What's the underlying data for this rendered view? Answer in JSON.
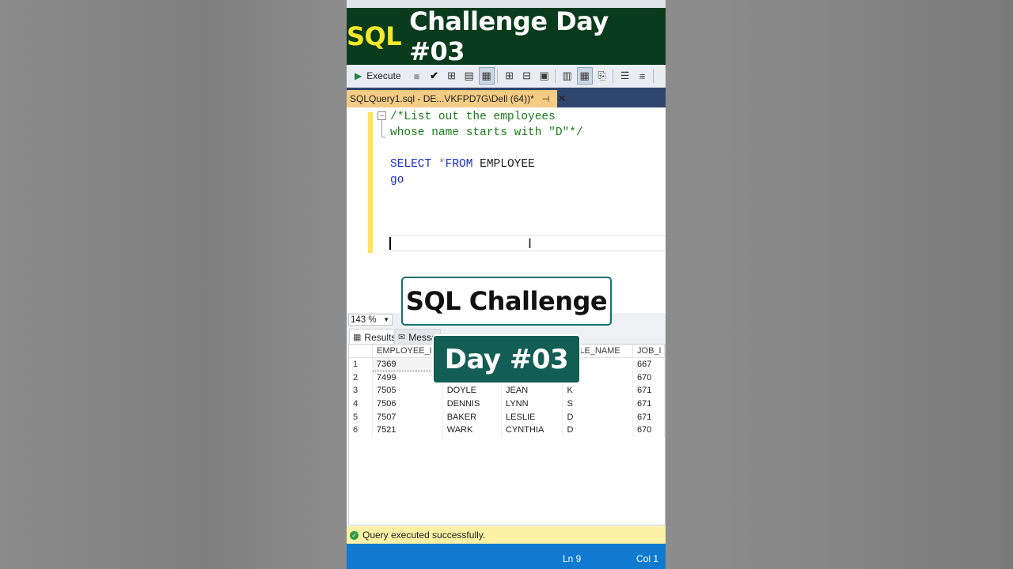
{
  "banner": {
    "keyword": "SQL",
    "rest": "Challenge Day #03"
  },
  "toolbar": {
    "execute_label": "Execute"
  },
  "editor_tab": {
    "title": "SQLQuery1.sql - DE...VKFPD7G\\Dell (64))*",
    "pin": "⊣",
    "close": "✕"
  },
  "code": {
    "line1": "/*List out the employees",
    "line2": "whose name starts with \"D\"*/",
    "select_kw": "SELECT",
    "star": "*",
    "from_kw": "FROM",
    "table": "EMPLOYEE",
    "go_kw": "go"
  },
  "zoom": {
    "value": "143 %"
  },
  "result_tabs": {
    "results": "Results",
    "messages": "Messa"
  },
  "grid": {
    "columns": [
      "EMPLOYEE_I",
      "",
      "",
      "DDLE_NAME",
      "JOB_I"
    ],
    "rows": [
      [
        "1",
        "7369",
        "",
        "",
        "",
        "667"
      ],
      [
        "2",
        "7499",
        "",
        "",
        "",
        "670"
      ],
      [
        "3",
        "7505",
        "DOYLE",
        "JEAN",
        "K",
        "671"
      ],
      [
        "4",
        "7506",
        "DENNIS",
        "LYNN",
        "S",
        "671"
      ],
      [
        "5",
        "7507",
        "BAKER",
        "LESLIE",
        "D",
        "671"
      ],
      [
        "6",
        "7521",
        "WARK",
        "CYNTHIA",
        "D",
        "670"
      ]
    ]
  },
  "status": {
    "message": "Query executed successfully."
  },
  "bottom": {
    "ln": "Ln 9",
    "col": "Col 1"
  },
  "overlay": {
    "title": "SQL Challenge",
    "day": "Day #03"
  },
  "colors": {
    "banner_bg": "#0a3b1c",
    "banner_keyword": "#f2e92a",
    "tab_active": "#f5cc84",
    "comment": "#1a7d1a",
    "keyword": "#1a2ec8",
    "status_ok": "#2e9b3f",
    "statusbar": "#0f7ad0",
    "overlay_accent": "#135e54"
  }
}
